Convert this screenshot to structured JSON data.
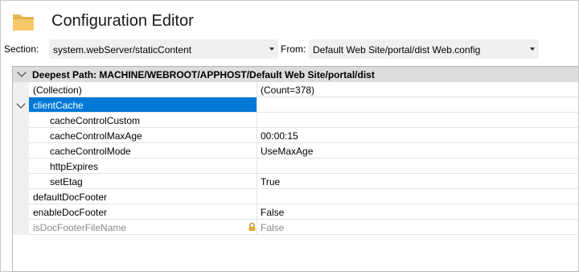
{
  "header": {
    "title": "Configuration Editor"
  },
  "toolbar": {
    "section_label": "Section:",
    "section_value": "system.webServer/staticContent",
    "from_label": "From:",
    "from_value": "Default Web Site/portal/dist Web.config"
  },
  "grid": {
    "deepest_path": "Deepest Path: MACHINE/WEBROOT/APPHOST/Default Web Site/portal/dist",
    "rows": [
      {
        "name": "(Collection)",
        "value": "(Count=378)"
      },
      {
        "name": "clientCache",
        "value": ""
      },
      {
        "name": "cacheControlCustom",
        "value": ""
      },
      {
        "name": "cacheControlMaxAge",
        "value": "00:00:15"
      },
      {
        "name": "cacheControlMode",
        "value": "UseMaxAge"
      },
      {
        "name": "httpExpires",
        "value": ""
      },
      {
        "name": "setEtag",
        "value": "True"
      },
      {
        "name": "defaultDocFooter",
        "value": ""
      },
      {
        "name": "enableDocFooter",
        "value": "False"
      },
      {
        "name": "isDocFooterFileName",
        "value": "False"
      }
    ]
  },
  "icons": {
    "header": "folder-icon",
    "locked_row": "lock-icon"
  },
  "colors": {
    "selection": "#0078d7",
    "header_band": "#dcdcdc",
    "disabled_text": "#8a8a8a",
    "folder": "#f5c86a"
  }
}
